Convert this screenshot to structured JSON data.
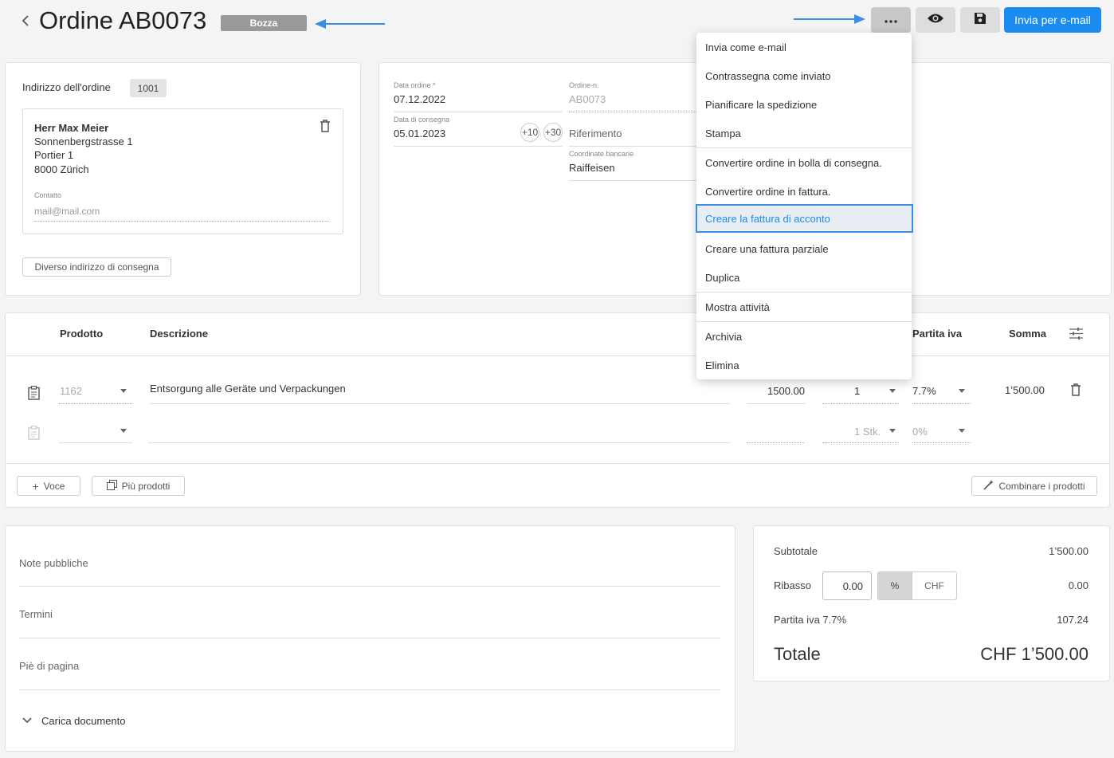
{
  "header": {
    "back_icon": "chevron-left-icon",
    "title": "Ordine AB0073",
    "status_badge": "Bozza",
    "more_icon": "ellipsis-icon",
    "preview_icon": "eye-icon",
    "save_icon": "floppy-disk-icon",
    "send_email_label": "Invia per e-mail",
    "accent_color": "#1a8cf0"
  },
  "address": {
    "label": "Indirizzo dell'ordine",
    "customer_number": "1001",
    "name": "Herr Max Meier",
    "street": "Sonnenbergstrasse 1",
    "line2": "Portier 1",
    "city": "8000 Zürich",
    "contact_label": "Contatto",
    "contact_value": "mail@mail.com",
    "delivery_button": "Diverso indirizzo di consegna"
  },
  "order_info": {
    "order_date_label": "Data ordine *",
    "order_date": "07.12.2022",
    "order_no_label": "Ordine-n.",
    "order_no": "AB0073",
    "delivery_date_label": "Data di consegna",
    "delivery_date": "05.01.2023",
    "plus10": "+10",
    "plus30": "+30",
    "reference_placeholder": "Riferimento",
    "bank_label": "Coordinate bancarie",
    "bank_value": "Raiffeisen"
  },
  "menu": {
    "items": [
      "Invia come e-mail",
      "Contrassegna come inviato",
      "Pianificare la spedizione",
      "Stampa",
      "Convertire ordine in bolla di consegna.",
      "Convertire ordine in fattura.",
      "Creare la fattura di acconto",
      "Creare una fattura parziale",
      "Duplica",
      "Mostra attività",
      "Archivia",
      "Elimina"
    ]
  },
  "table": {
    "headers": {
      "product": "Prodotto",
      "description": "Descrizione",
      "vat": "Partita iva",
      "sum": "Somma"
    },
    "rows": [
      {
        "product": "1162",
        "description": "Entsorgung alle Geräte und Verpackungen",
        "price": "1500.00",
        "qty": "1",
        "vat": "7.7%",
        "sum": "1’500.00"
      },
      {
        "product": "",
        "description": "",
        "price": "",
        "qty": "1 Stk.",
        "vat": "0%",
        "sum": ""
      }
    ],
    "add_item_label": "Voce",
    "more_products_label": "Più prodotti",
    "combine_label": "Combinare i prodotti"
  },
  "notes": {
    "public_notes": "Note pubbliche",
    "terms": "Termini",
    "footer": "Piè di pagina",
    "upload": "Carica documento"
  },
  "totals": {
    "subtotal_label": "Subtotale",
    "subtotal": "1’500.00",
    "discount_label": "Ribasso",
    "discount_input": "0.00",
    "discount_percent": "%",
    "discount_chf": "CHF",
    "discount_value": "0.00",
    "vat_label": "Partita iva 7.7%",
    "vat_value": "107.24",
    "total_label": "Totale",
    "total_value": "CHF 1’500.00"
  }
}
